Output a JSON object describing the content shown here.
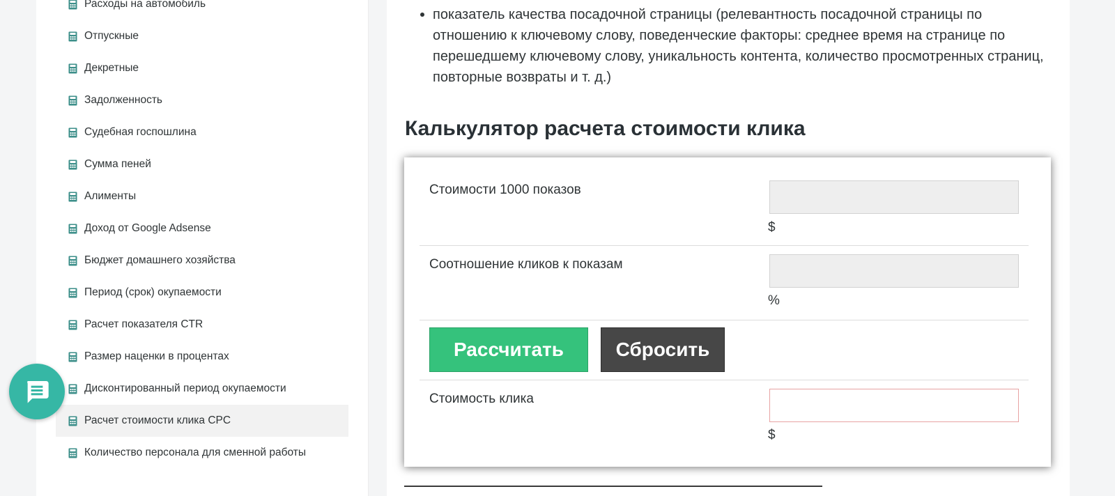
{
  "sidebar": {
    "items": [
      {
        "label": "Расходы на автомобиль",
        "active": false
      },
      {
        "label": "Отпускные",
        "active": false
      },
      {
        "label": "Декретные",
        "active": false
      },
      {
        "label": "Задолженность",
        "active": false
      },
      {
        "label": "Судебная госпошлина",
        "active": false
      },
      {
        "label": "Сумма пеней",
        "active": false
      },
      {
        "label": "Алименты",
        "active": false
      },
      {
        "label": "Доход от Google Adsense",
        "active": false
      },
      {
        "label": "Бюджет домашнего хозяйства",
        "active": false
      },
      {
        "label": "Период (срок) окупаемости",
        "active": false
      },
      {
        "label": "Расчет показателя CTR",
        "active": false
      },
      {
        "label": "Размер наценки в процентах",
        "active": false
      },
      {
        "label": "Дисконтированный период окупаемости",
        "active": false
      },
      {
        "label": "Расчет стоимости клика CPC",
        "active": true
      },
      {
        "label": "Количество персонала для сменной работы",
        "active": false
      }
    ],
    "icon": "calculator-icon"
  },
  "content": {
    "bullet_text": "показатель качества посадочной страницы (релевантность посадочной страницы по отношению к ключевому слову, поведенческие факторы: среднее время на странице по перешедшему ключевому слову, уникальность контента, количество просмотренных страниц, повторные возвраты и т. д.)",
    "section_title": "Калькулятор расчета стоимости клика"
  },
  "calculator": {
    "cpm": {
      "label": "Стоимости 1000 показов",
      "value": "",
      "unit": "$"
    },
    "ctr": {
      "label": "Соотношение кликов к показам",
      "value": "",
      "unit": "%"
    },
    "calculate_label": "Рассчитать",
    "reset_label": "Сбросить",
    "cpc": {
      "label": "Стоимость клика",
      "value": "",
      "unit": "$"
    }
  },
  "chat": {
    "icon": "chat-icon"
  },
  "colors": {
    "accent_green": "#35c27c",
    "reset_dark": "#474747",
    "chat_teal": "#36b7a5",
    "icon_teal": "#3d8f8a"
  }
}
